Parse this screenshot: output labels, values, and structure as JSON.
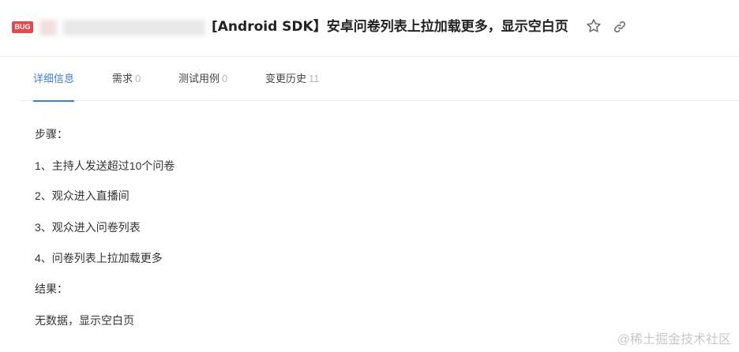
{
  "header": {
    "badge": "BUG",
    "title": "[Android SDK】安卓问卷列表上拉加载更多，显示空白页"
  },
  "tabs": [
    {
      "label": "详细信息",
      "count": ""
    },
    {
      "label": "需求",
      "count": "0"
    },
    {
      "label": "测试用例",
      "count": "0"
    },
    {
      "label": "变更历史",
      "count": "11"
    }
  ],
  "content": {
    "lines": [
      "步骤：",
      "1、主持人发送超过10个问卷",
      "2、观众进入直播间",
      "3、观众进入问卷列表",
      "4、问卷列表上拉加载更多",
      "结果：",
      "无数据，显示空白页"
    ]
  },
  "watermark": "@稀土掘金技术社区",
  "colors": {
    "accent": "#3d7dd8",
    "badge": "#e5484d"
  }
}
